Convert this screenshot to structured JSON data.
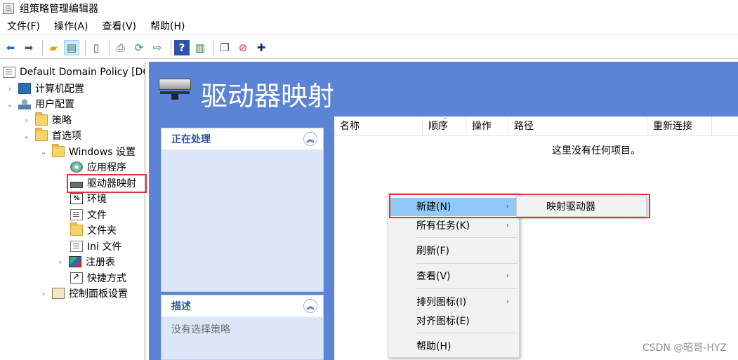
{
  "window": {
    "title": "组策略管理编辑器"
  },
  "menubar": [
    "文件(F)",
    "操作(A)",
    "查看(V)",
    "帮助(H)"
  ],
  "toolbar": {
    "buttons": [
      "back-icon",
      "forward-icon",
      "up-folder-icon",
      "show-hide-tree-icon",
      "properties-icon",
      "print-icon",
      "refresh-icon",
      "export-list-icon",
      "help-icon",
      "show-hide-action-pane-icon",
      "new-window-icon",
      "delete-icon",
      "add-icon"
    ]
  },
  "tree": {
    "root": "Default Domain Policy [DC",
    "computer_config": "计算机配置",
    "user_config": "用户配置",
    "policies": "策略",
    "preferences": "首选项",
    "windows_settings": "Windows 设置",
    "items": [
      "应用程序",
      "驱动器映射",
      "环境",
      "文件",
      "文件夹",
      "Ini 文件",
      "注册表",
      "快捷方式"
    ],
    "control_panel": "控制面板设置"
  },
  "banner": {
    "title": "驱动器映射"
  },
  "cards": {
    "processing": {
      "title": "正在处理"
    },
    "description": {
      "title": "描述",
      "text": "没有选择策略"
    }
  },
  "listview": {
    "columns": [
      "名称",
      "顺序",
      "操作",
      "路径",
      "重新连接"
    ],
    "empty_text": "这里没有任何项目。"
  },
  "context_menu": {
    "items": [
      "新建(N)",
      "所有任务(K)",
      "刷新(F)",
      "查看(V)",
      "排列图标(I)",
      "对齐图标(E)",
      "帮助(H)"
    ],
    "submenu": [
      "映射驱动器"
    ]
  },
  "watermark": "CSDN @昭哥-HYZ"
}
